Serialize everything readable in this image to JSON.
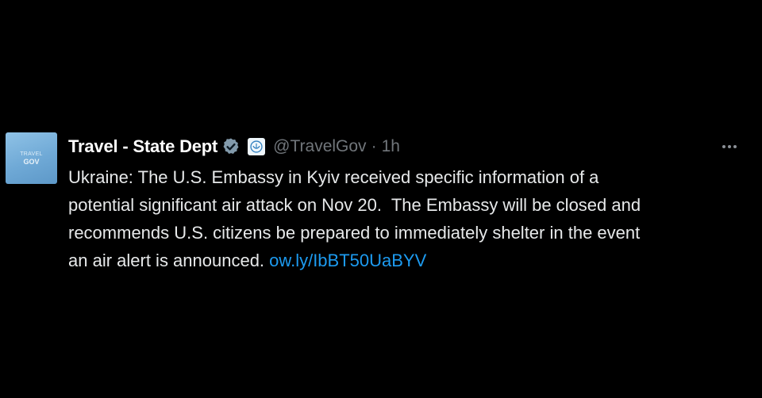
{
  "avatar": {
    "line1": "TRAVEL",
    "line2": "GOV",
    "color": "#7fb6de"
  },
  "tweet": {
    "display_name": "Travel - State Dept",
    "handle": "@TravelGov",
    "separator": "·",
    "time": "1h",
    "verified_icon": "verified-badge-icon",
    "affiliation_icon": "state-dept-affiliation-icon",
    "more_icon": "more-options-icon",
    "lines": [
      "Ukraine: The U.S. Embassy in Kyiv received specific information of a",
      "potential significant air attack on Nov 20.  The Embassy will be closed and",
      "recommends U.S. citizens be prepared to immediately shelter in the event",
      "an air alert is announced. "
    ],
    "link": "ow.ly/IbBT50UaBYV"
  },
  "colors": {
    "background": "#000000",
    "text": "#e7e9ea",
    "secondary": "#71767b",
    "link": "#1d9bf0"
  }
}
